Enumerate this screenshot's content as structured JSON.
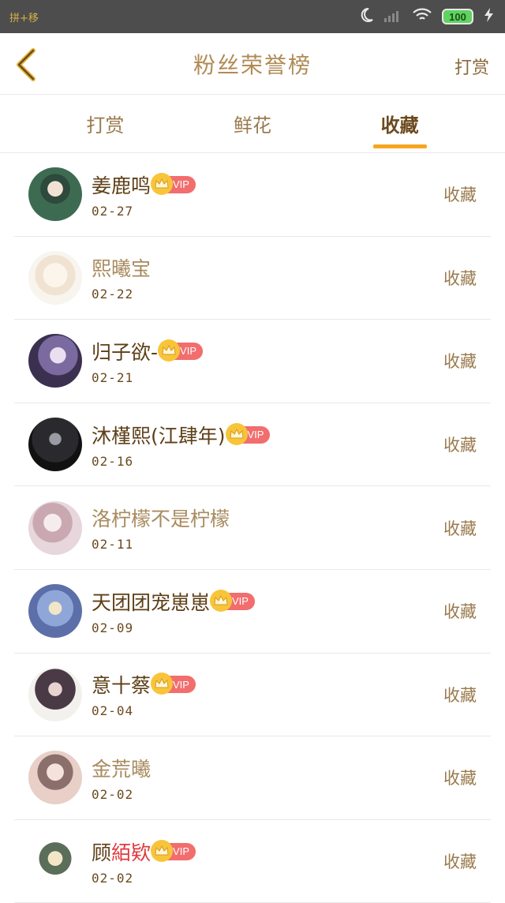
{
  "status": {
    "carrier": "拼+移",
    "battery": "100"
  },
  "nav": {
    "title": "粉丝荣誉榜",
    "right_label": "打赏"
  },
  "tabs": [
    {
      "label": "打赏"
    },
    {
      "label": "鲜花"
    },
    {
      "label": "收藏"
    }
  ],
  "rows": [
    {
      "name": "姜鹿鸣",
      "vip": "VIP",
      "date": "02-27",
      "action": "收藏",
      "avatar_color": "#3d6b52"
    },
    {
      "name": "熙曦宝",
      "vip": "",
      "date": "02-22",
      "action": "收藏",
      "avatar_color": "#f3efe8"
    },
    {
      "name": "归子欲-",
      "vip": "VIP",
      "date": "02-21",
      "action": "收藏",
      "avatar_color": "#7a6aa0"
    },
    {
      "name": "沐槿熙(江肆年)",
      "vip": "VIP",
      "date": "02-16",
      "action": "收藏",
      "avatar_color": "#2a2a2e"
    },
    {
      "name": "洛柠檬不是柠檬",
      "vip": "",
      "date": "02-11",
      "action": "收藏",
      "avatar_color": "#e7d6dc"
    },
    {
      "name": "天团团宠崽崽",
      "vip": "VIP",
      "date": "02-09",
      "action": "收藏",
      "avatar_color": "#8fa7d8"
    },
    {
      "name": "意十蔡",
      "vip": "VIP",
      "date": "02-04",
      "action": "收藏",
      "avatar_color": "#4a3a45"
    },
    {
      "name": "金荒曦",
      "vip": "",
      "date": "02-02",
      "action": "收藏",
      "avatar_color": "#e8cfc8"
    },
    {
      "name_plain": "顾",
      "name_red": "絔欵",
      "vip": "VIP",
      "date": "02-02",
      "action": "收藏",
      "avatar_color": "#5a6e5a"
    }
  ],
  "colors": {
    "accent": "#f5a623",
    "vip_badge": "#f26d6d",
    "crown": "#f8c53a"
  }
}
